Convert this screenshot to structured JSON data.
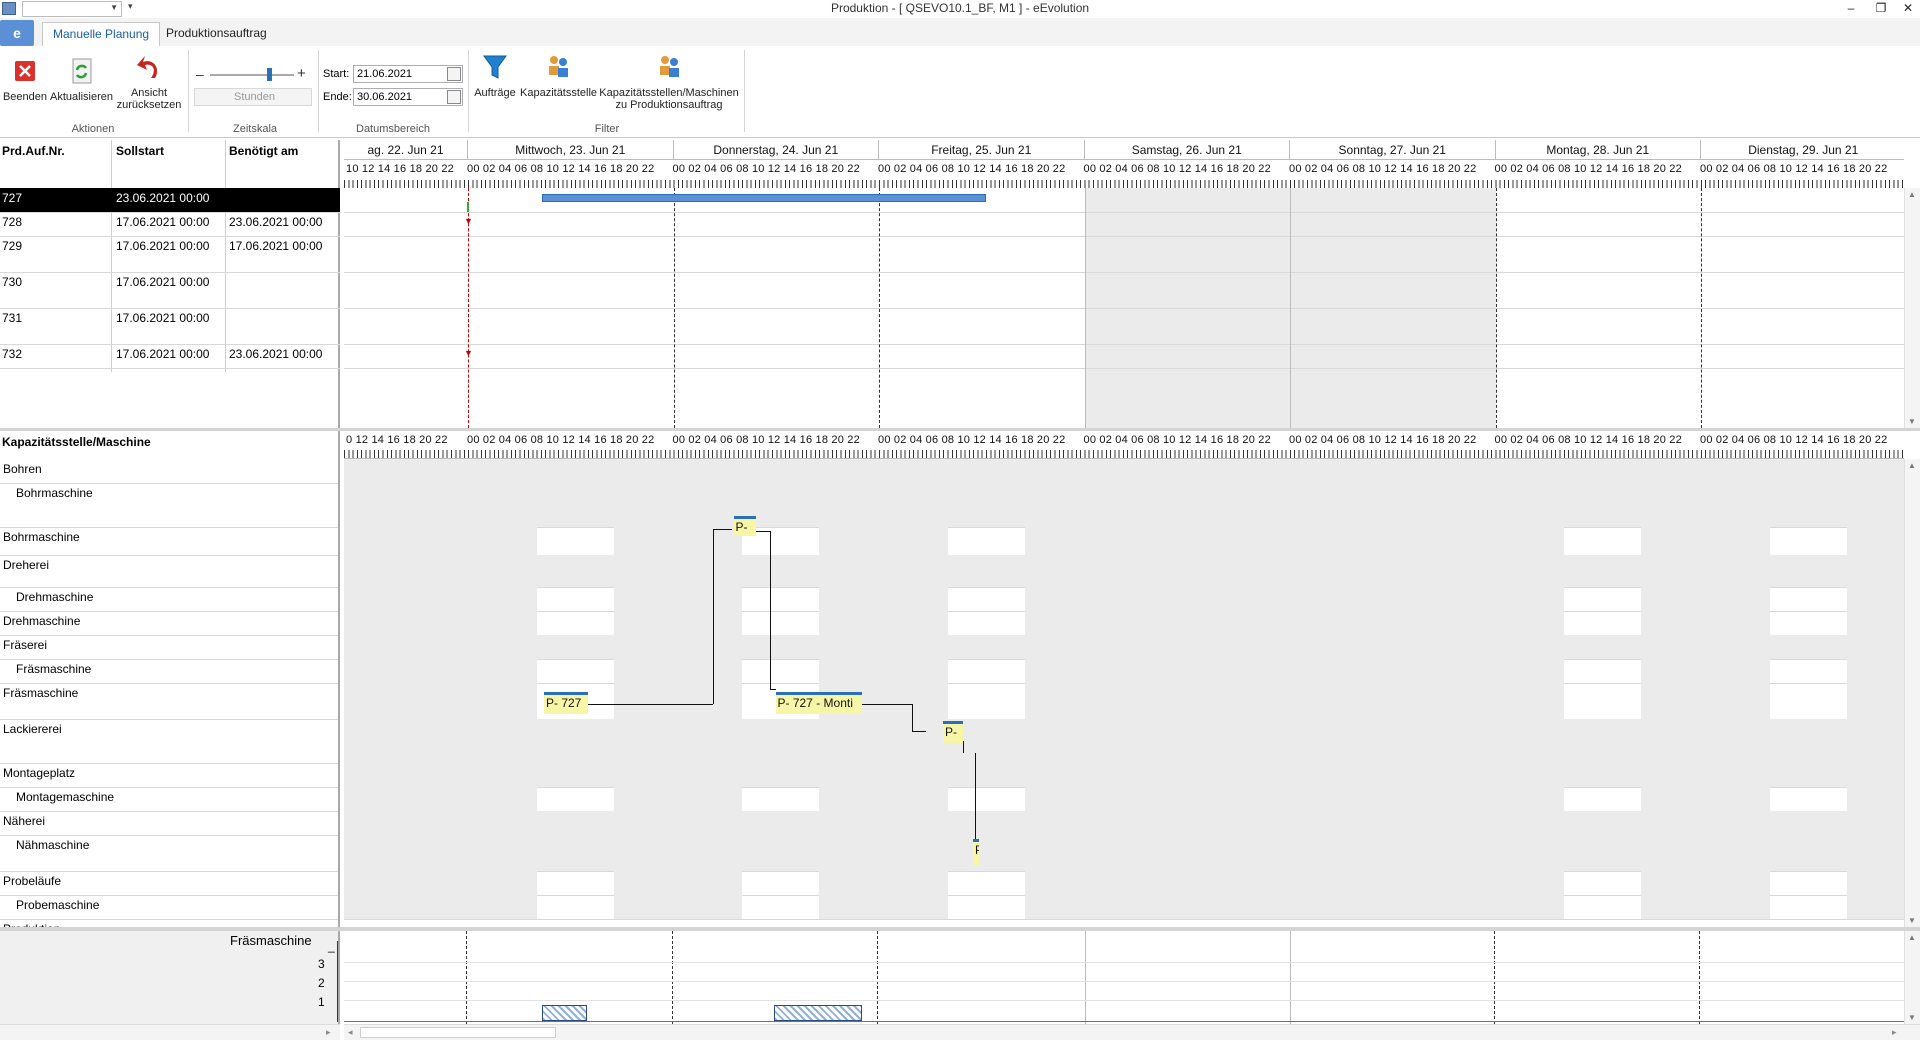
{
  "window": {
    "title": "Produktion - [ QSEVO10.1_BF, M1 ]  -  eEvolution",
    "minimize": "–",
    "restore": "❐",
    "close": "✕"
  },
  "tabs": [
    {
      "label": "Manuelle Planung",
      "active": true
    },
    {
      "label": "Produktionsauftrag",
      "active": false
    }
  ],
  "ribbon": {
    "groups": {
      "aktionen": "Aktionen",
      "zeitskala": "Zeitskala",
      "datumsbereich": "Datumsbereich",
      "filter": "Filter"
    },
    "buttons": {
      "beenden": "Beenden",
      "aktualisieren": "Aktualisieren",
      "ansicht_1": "Ansicht",
      "ansicht_2": "zurücksetzen",
      "stunden": "Stunden",
      "auftraege": "Aufträge",
      "kapazitaetsstelle": "Kapazitätsstelle",
      "kap_masch_1": "Kapazitätsstellen/Maschinen",
      "kap_masch_2": "zu Produktionsauftrag"
    },
    "zoom": {
      "minus": "–",
      "plus": "+",
      "level": 0.7
    },
    "date": {
      "start_label": "Start:",
      "start_value": "21.06.2021",
      "end_label": "Ende:",
      "end_value": "30.06.2021"
    }
  },
  "orders": {
    "headers": [
      "Prd.Auf.Nr.",
      "Sollstart",
      "Benötigt am"
    ],
    "rows": [
      {
        "nr": "727",
        "sollstart": "23.06.2021 00:00",
        "benoetigt": "",
        "selected": true
      },
      {
        "nr": "728",
        "sollstart": "17.06.2021 00:00",
        "benoetigt": "23.06.2021 00:00"
      },
      {
        "nr": "729",
        "sollstart": "17.06.2021 00:00",
        "benoetigt": "17.06.2021 00:00"
      },
      {
        "nr": "730",
        "sollstart": "17.06.2021 00:00",
        "benoetigt": ""
      },
      {
        "nr": "731",
        "sollstart": "17.06.2021 00:00",
        "benoetigt": ""
      },
      {
        "nr": "732",
        "sollstart": "17.06.2021 00:00",
        "benoetigt": "23.06.2021 00:00"
      }
    ]
  },
  "timeline": {
    "days": [
      "ag. 22. Jun 21",
      "Mittwoch, 23. Jun 21",
      "Donnerstag, 24. Jun 21",
      "Freitag, 25. Jun 21",
      "Samstag, 26. Jun 21",
      "Sonntag, 27. Jun 21",
      "Montag, 28. Jun 21",
      "Dienstag, 29. Jun 21"
    ],
    "hours_first": "10 12 14 16 18 20 22",
    "hours_day": "00 02 04 06 08 10 12 14 16 18 20 22",
    "hours_first_res": "0 12 14 16 18 20 22"
  },
  "resources": {
    "header": "Kapazitätsstelle/Maschine",
    "rows": [
      {
        "label": "Bohren",
        "indent": false
      },
      {
        "label": "Bohrmaschine",
        "indent": true
      },
      {
        "label": "Bohrmaschine",
        "indent": false
      },
      {
        "label": "Dreherei",
        "indent": false
      },
      {
        "label": "Drehmaschine",
        "indent": true
      },
      {
        "label": "Drehmaschine",
        "indent": false
      },
      {
        "label": "Fräserei",
        "indent": false
      },
      {
        "label": "Fräsmaschine",
        "indent": true
      },
      {
        "label": "Fräsmaschine",
        "indent": false
      },
      {
        "label": "Lackiererei",
        "indent": false
      },
      {
        "label": "Montageplatz",
        "indent": false
      },
      {
        "label": "Montagemaschine",
        "indent": true
      },
      {
        "label": "Näherei",
        "indent": false
      },
      {
        "label": "Nähmaschine",
        "indent": true
      },
      {
        "label": "Probeläufe",
        "indent": false
      },
      {
        "label": "Probemaschine",
        "indent": true
      },
      {
        "label": "Produktion",
        "indent": false
      }
    ]
  },
  "tasks": {
    "bohr": "P-",
    "fraes1": "P- 727",
    "fraes2": "P- 727 - Monti",
    "lack": "P-",
    "naeh": "P"
  },
  "load": {
    "title": "Fräsmaschine",
    "yticks": [
      "3",
      "2",
      "1"
    ],
    "ymax_tick": "_"
  },
  "colors": {
    "accent": "#2c6fb6",
    "task_fill": "#f7f5a6",
    "weekend": "#ebebeb",
    "selected_row": "#000000"
  }
}
